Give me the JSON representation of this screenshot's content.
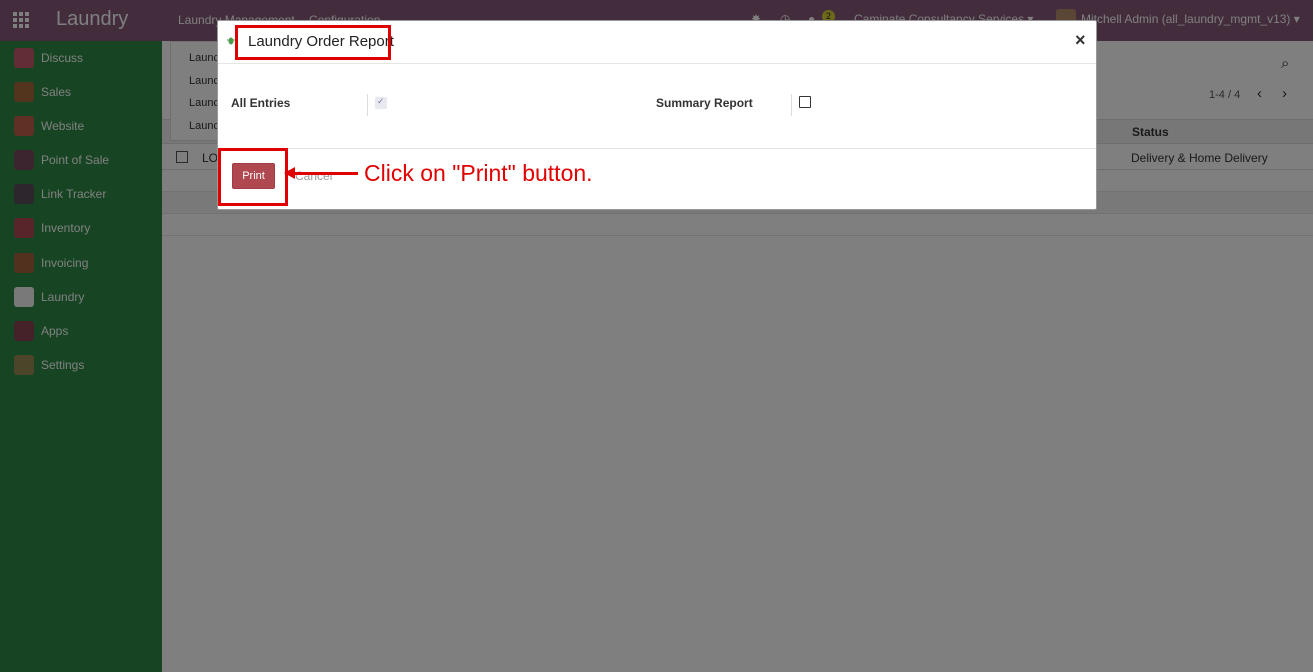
{
  "navbar": {
    "app_title": "Laundry",
    "menus": [
      "Laundry Management",
      "Configuration"
    ],
    "message_count": "2",
    "company": "Caminate Consultancy Services",
    "user": "Mitchell Admin (all_laundry_mgmt_v13)"
  },
  "sidebar": {
    "items": [
      {
        "label": "Discuss",
        "icon": "chat-icon",
        "color": "#c65a6b"
      },
      {
        "label": "Sales",
        "icon": "chart-icon",
        "color": "#a66a3c"
      },
      {
        "label": "Website",
        "icon": "globe-icon",
        "color": "#c0614a"
      },
      {
        "label": "Point of Sale",
        "icon": "store-icon",
        "color": "#7a4a5e"
      },
      {
        "label": "Link Tracker",
        "icon": "link-icon",
        "color": "#5a4e5a"
      },
      {
        "label": "Inventory",
        "icon": "boxes-icon",
        "color": "#b04a56"
      },
      {
        "label": "Invoicing",
        "icon": "invoice-icon",
        "color": "#a4643c"
      },
      {
        "label": "Laundry",
        "icon": "laundry-icon",
        "color": "#f3f3f3"
      },
      {
        "label": "Apps",
        "icon": "apps-cube-icon",
        "color": "#8a4455"
      },
      {
        "label": "Settings",
        "icon": "gear-icon",
        "color": "#9a8a52"
      }
    ]
  },
  "dropdown": {
    "items": [
      "Launc",
      "Launc",
      "Launc",
      "Launc"
    ]
  },
  "list": {
    "pager": "1-4 / 4",
    "status_header": "Status",
    "row_ref": "LO",
    "row_status": "Delivery & Home Delivery"
  },
  "dialog": {
    "title": "Laundry Order Report",
    "close_glyph": "×",
    "all_entries_label": "All Entries",
    "all_entries_checked": true,
    "summary_label": "Summary Report",
    "summary_checked": false,
    "print_label": "Print",
    "cancel_label": "Cancel"
  },
  "annotation": {
    "text": "Click on \"Print\" button.",
    "color": "#e00000"
  },
  "colors": {
    "navbar": "#875A7B",
    "sidebar": "#2e8b47",
    "primary_button": "#b04850"
  }
}
